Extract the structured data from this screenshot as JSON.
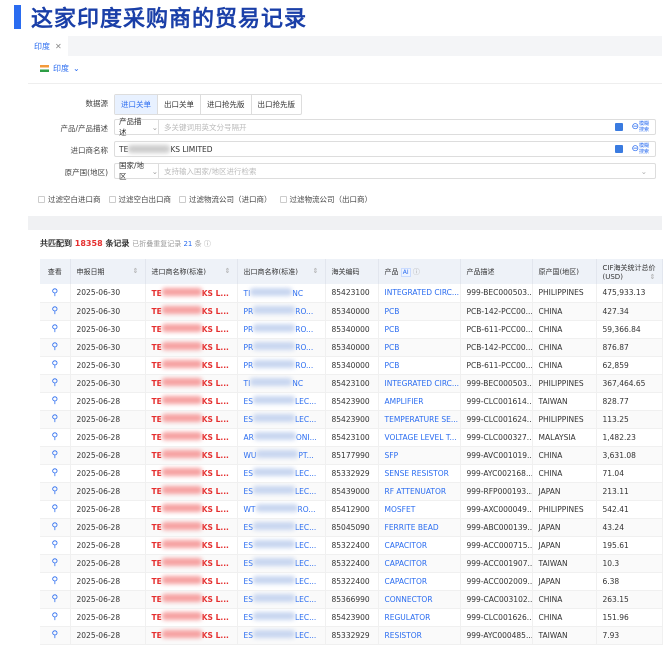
{
  "title": "这家印度采购商的贸易记录",
  "tab": {
    "label": "印度",
    "close": "✕"
  },
  "country": {
    "label": "印度",
    "chevron": "⌄"
  },
  "filters": {
    "datasource_label": "数据源",
    "datasource_options": [
      "进口关单",
      "出口关单",
      "进口抢先版",
      "出口抢先版"
    ],
    "datasource_selected": "进口关单",
    "product_label": "产品/产品描述",
    "product_select": "产品描述",
    "product_placeholder": "多关键词用英文分号隔开",
    "importer_label": "进口商名称",
    "importer_prefix": "TE",
    "importer_suffix": "KS LIMITED",
    "origin_label": "原产国(地区)",
    "origin_select": "国家/地区",
    "origin_placeholder": "支持输入国家/地区进行检索",
    "fuzzy_search": "模糊搜索",
    "checkboxes": [
      "过滤空白进口商",
      "过滤空白出口商",
      "过滤物流公司（进口商）",
      "过滤物流公司（出口商）"
    ]
  },
  "summary": {
    "prefix": "共匹配到",
    "count": "18358",
    "suffix": "条记录",
    "folded_prefix": "已折叠重复记录",
    "folded_count": "21",
    "folded_suffix": "条"
  },
  "table": {
    "headers": [
      "查看",
      "申报日期",
      "进口商名称(标准)",
      "出口商名称(标准)",
      "海关编码",
      "产品",
      "产品描述",
      "原产国(地区)",
      "CIF海关统计总价(USD)"
    ],
    "ai_badge": "AI",
    "rows": [
      {
        "date": "2025-06-30",
        "imp_a": "TE",
        "imp_b": "KS L...",
        "exp_a": "TI",
        "exp_b": "NC",
        "hs": "85423100",
        "product": "INTEGRATED CIRC...",
        "desc": "999-BEC000503...",
        "origin": "PHILIPPINES",
        "cif": "475,933.13"
      },
      {
        "date": "2025-06-30",
        "imp_a": "TE",
        "imp_b": "KS L...",
        "exp_a": "PR",
        "exp_b": "RO...",
        "hs": "85340000",
        "product": "PCB",
        "desc": "PCB-142-PCC00...",
        "origin": "CHINA",
        "cif": "427.34"
      },
      {
        "date": "2025-06-30",
        "imp_a": "TE",
        "imp_b": "KS L...",
        "exp_a": "PR",
        "exp_b": "RO...",
        "hs": "85340000",
        "product": "PCB",
        "desc": "PCB-611-PCC00...",
        "origin": "CHINA",
        "cif": "59,366.84"
      },
      {
        "date": "2025-06-30",
        "imp_a": "TE",
        "imp_b": "KS L...",
        "exp_a": "PR",
        "exp_b": "RO...",
        "hs": "85340000",
        "product": "PCB",
        "desc": "PCB-142-PCC00...",
        "origin": "CHINA",
        "cif": "876.87"
      },
      {
        "date": "2025-06-30",
        "imp_a": "TE",
        "imp_b": "KS L...",
        "exp_a": "PR",
        "exp_b": "RO...",
        "hs": "85340000",
        "product": "PCB",
        "desc": "PCB-611-PCC00...",
        "origin": "CHINA",
        "cif": "62,859"
      },
      {
        "date": "2025-06-30",
        "imp_a": "TE",
        "imp_b": "KS L...",
        "exp_a": "TI",
        "exp_b": "NC",
        "hs": "85423100",
        "product": "INTEGRATED CIRC...",
        "desc": "999-BEC000503...",
        "origin": "PHILIPPINES",
        "cif": "367,464.65"
      },
      {
        "date": "2025-06-28",
        "imp_a": "TE",
        "imp_b": "KS L...",
        "exp_a": "ES",
        "exp_b": "LEC...",
        "hs": "85423900",
        "product": "AMPLIFIER",
        "desc": "999-CLC001614...",
        "origin": "TAIWAN",
        "cif": "828.77"
      },
      {
        "date": "2025-06-28",
        "imp_a": "TE",
        "imp_b": "KS L...",
        "exp_a": "ES",
        "exp_b": "LEC...",
        "hs": "85423900",
        "product": "TEMPERATURE SE...",
        "desc": "999-CLC001624...",
        "origin": "PHILIPPINES",
        "cif": "113.25"
      },
      {
        "date": "2025-06-28",
        "imp_a": "TE",
        "imp_b": "KS L...",
        "exp_a": "AR",
        "exp_b": "ONI...",
        "hs": "85423100",
        "product": "VOLTAGE LEVEL T...",
        "desc": "999-CLC000327...",
        "origin": "MALAYSIA",
        "cif": "1,482.23"
      },
      {
        "date": "2025-06-28",
        "imp_a": "TE",
        "imp_b": "KS L...",
        "exp_a": "WU",
        "exp_b": "PT...",
        "hs": "85177990",
        "product": "SFP",
        "desc": "999-AVC001019...",
        "origin": "CHINA",
        "cif": "3,631.08"
      },
      {
        "date": "2025-06-28",
        "imp_a": "TE",
        "imp_b": "KS L...",
        "exp_a": "ES",
        "exp_b": "LEC...",
        "hs": "85332929",
        "product": "SENSE RESISTOR",
        "desc": "999-AYC002168...",
        "origin": "CHINA",
        "cif": "71.04"
      },
      {
        "date": "2025-06-28",
        "imp_a": "TE",
        "imp_b": "KS L...",
        "exp_a": "ES",
        "exp_b": "LEC...",
        "hs": "85439000",
        "product": "RF ATTENUATOR",
        "desc": "999-RFP000193...",
        "origin": "JAPAN",
        "cif": "213.11"
      },
      {
        "date": "2025-06-28",
        "imp_a": "TE",
        "imp_b": "KS L...",
        "exp_a": "WT",
        "exp_b": "RO...",
        "hs": "85412900",
        "product": "MOSFET",
        "desc": "999-AXC000049...",
        "origin": "PHILIPPINES",
        "cif": "542.41"
      },
      {
        "date": "2025-06-28",
        "imp_a": "TE",
        "imp_b": "KS L...",
        "exp_a": "ES",
        "exp_b": "LEC...",
        "hs": "85045090",
        "product": "FERRITE BEAD",
        "desc": "999-ABC000139...",
        "origin": "JAPAN",
        "cif": "43.24"
      },
      {
        "date": "2025-06-28",
        "imp_a": "TE",
        "imp_b": "KS L...",
        "exp_a": "ES",
        "exp_b": "LEC...",
        "hs": "85322400",
        "product": "CAPACITOR",
        "desc": "999-ACC000715...",
        "origin": "JAPAN",
        "cif": "195.61"
      },
      {
        "date": "2025-06-28",
        "imp_a": "TE",
        "imp_b": "KS L...",
        "exp_a": "ES",
        "exp_b": "LEC...",
        "hs": "85322400",
        "product": "CAPACITOR",
        "desc": "999-ACC001907...",
        "origin": "TAIWAN",
        "cif": "10.3"
      },
      {
        "date": "2025-06-28",
        "imp_a": "TE",
        "imp_b": "KS L...",
        "exp_a": "ES",
        "exp_b": "LEC...",
        "hs": "85322400",
        "product": "CAPACITOR",
        "desc": "999-ACC002009...",
        "origin": "JAPAN",
        "cif": "6.38"
      },
      {
        "date": "2025-06-28",
        "imp_a": "TE",
        "imp_b": "KS L...",
        "exp_a": "ES",
        "exp_b": "LEC...",
        "hs": "85366990",
        "product": "CONNECTOR",
        "desc": "999-CAC003102...",
        "origin": "CHINA",
        "cif": "263.15"
      },
      {
        "date": "2025-06-28",
        "imp_a": "TE",
        "imp_b": "KS L...",
        "exp_a": "ES",
        "exp_b": "LEC...",
        "hs": "85423900",
        "product": "REGULATOR",
        "desc": "999-CLC001626...",
        "origin": "CHINA",
        "cif": "151.96"
      },
      {
        "date": "2025-06-28",
        "imp_a": "TE",
        "imp_b": "KS L...",
        "exp_a": "ES",
        "exp_b": "LEC...",
        "hs": "85332929",
        "product": "RESISTOR",
        "desc": "999-AYC000485...",
        "origin": "TAIWAN",
        "cif": "7.93"
      }
    ]
  },
  "colors": {
    "accent": "#2a6cf0",
    "importer": "#e52e2e",
    "title": "#1a3fa8"
  }
}
